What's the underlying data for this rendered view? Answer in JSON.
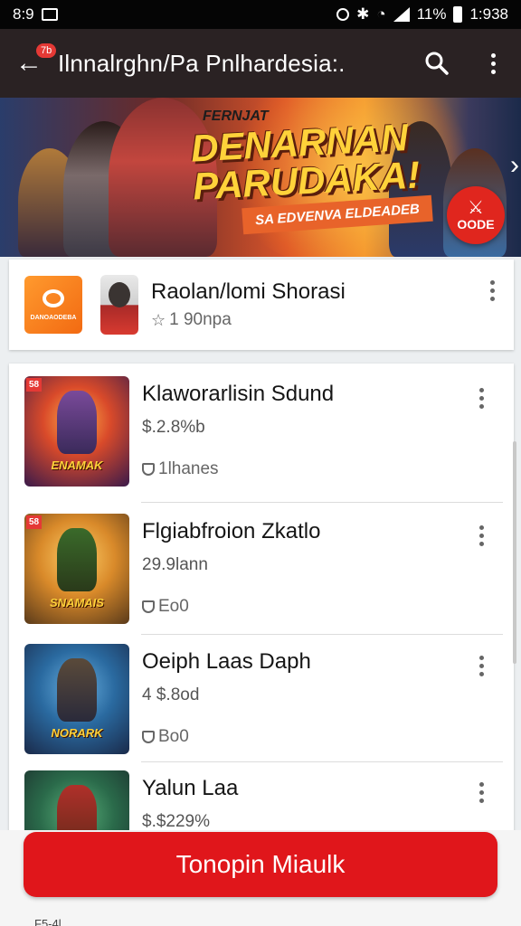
{
  "status_bar": {
    "time_left": "8:9",
    "battery_percent": "11%",
    "time_right": "1:938"
  },
  "app_bar": {
    "back_badge": "7b",
    "title": "Ilnnalrghn/Pa Pnlhardesia:."
  },
  "hero": {
    "kicker": "FERNJAT",
    "title_line1": "DENARNAN",
    "title_line2": "PARUDAKA!",
    "subtitle": "SA EDVENVA ELDEADEB",
    "fab_label": "OODE"
  },
  "featured_item": {
    "logo_text": "DANOAODEBA",
    "name": "Raolan/lomi Shorasi",
    "meta": "1 90npa"
  },
  "items": [
    {
      "badge": "58",
      "thumb_label": "ENAMAK",
      "name": "Klaworarlisin Sdund",
      "price": "$.2.8%b",
      "meta": "1lhanes"
    },
    {
      "badge": "58",
      "thumb_label": "SNAMAIS",
      "name": "Flgiabfroion Zkatlo",
      "price": "29.9lann",
      "meta": "Eo0"
    },
    {
      "badge": "",
      "thumb_label": "NORARK",
      "name": "Oeiph Laas Daph",
      "price": "4 $.8od",
      "meta": "Bo0"
    },
    {
      "badge": "",
      "thumb_label": "",
      "name": "Yalun Laa",
      "price": "$.$229%",
      "meta": ""
    }
  ],
  "cta_label": "Tonopin Miaulk",
  "bottom_note": "F5-4l",
  "colors": {
    "app_bar": "#2a2223",
    "accent_red": "#e0161b",
    "status_bar": "#050505"
  }
}
